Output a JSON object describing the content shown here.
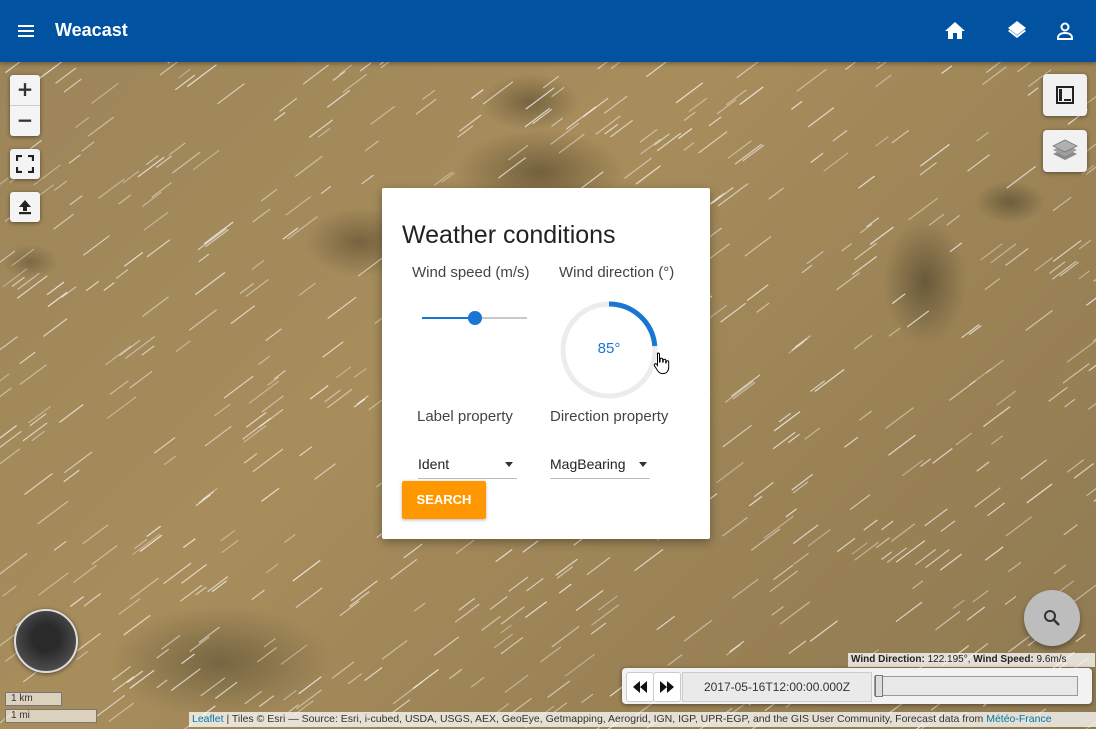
{
  "app": {
    "title": "Weacast"
  },
  "header": {
    "menu_icon": "menu-icon",
    "actions": [
      {
        "name": "home-button",
        "icon": "home-icon"
      },
      {
        "name": "layers-button",
        "icon": "layers-icon"
      },
      {
        "name": "account-button",
        "icon": "person-icon"
      }
    ]
  },
  "map_controls": {
    "zoom_in": "+",
    "zoom_out": "−",
    "fullscreen_icon": "fullscreen-icon",
    "upload_icon": "upload-icon"
  },
  "dialog": {
    "title": "Weather conditions",
    "wind_speed_label": "Wind speed (m/s)",
    "wind_speed_level": 0.5,
    "wind_direction_label": "Wind direction (°)",
    "wind_direction_value": "85°",
    "wind_direction_degrees": 85,
    "label_property_label": "Label property",
    "label_property_value": "Ident",
    "direction_property_label": "Direction property",
    "direction_property_value": "MagBearing",
    "search_label": "SEARCH"
  },
  "wind_info": {
    "direction_label": "Wind Direction:",
    "direction_value": "122.195°,",
    "speed_label": "Wind Speed:",
    "speed_value": "9.6m/s"
  },
  "timeline": {
    "time": "2017-05-16T12:00:00.000Z",
    "position": 0
  },
  "scale": {
    "metric": "1 km",
    "imperial": "1 mi"
  },
  "attribution": {
    "leaflet": "Leaflet",
    "text": " | Tiles © Esri — Source: Esri, i-cubed, USDA, USGS, AEX, GeoEye, Getmapping, Aerogrid, IGN, IGP, UPR-EGP, and the GIS User Community, Forecast data from ",
    "meteo": "Météo-France"
  },
  "colors": {
    "appbar": "#0152a0",
    "accent": "#1976d2",
    "search_button": "#ff9800"
  }
}
